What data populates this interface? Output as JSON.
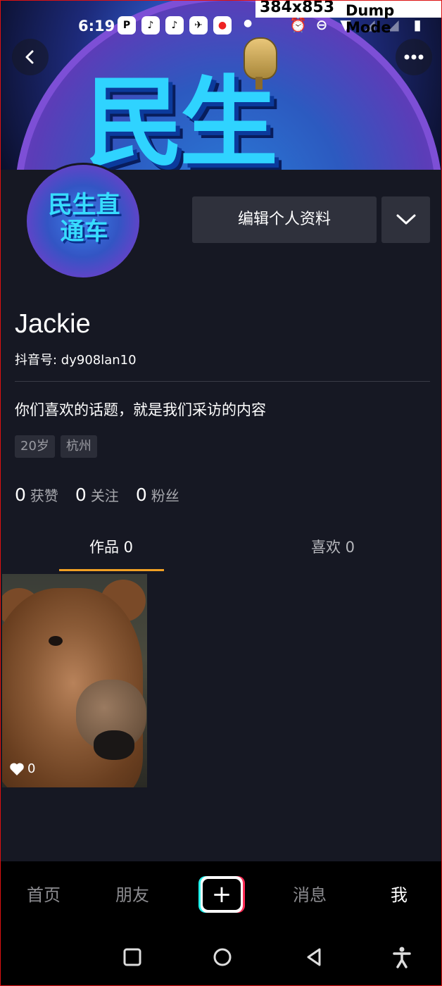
{
  "status_bar": {
    "time": "6:19",
    "debug_resolution": "384x853",
    "debug_mode": "Dump Mode",
    "notification_icons": [
      "P",
      "♪",
      "♪",
      "✈",
      "●"
    ]
  },
  "header": {
    "banner_text": "民生",
    "back_icon": "chevron-left-icon",
    "more_icon": "more-horizontal-icon"
  },
  "profile": {
    "avatar_text": "民生直通车",
    "edit_button_label": "编辑个人资料",
    "name": "Jackie",
    "douyin_id": "抖音号: dy908lan10",
    "bio": "你们喜欢的话题，就是我们采访的内容",
    "tags": [
      "20岁",
      "杭州"
    ],
    "stats": [
      {
        "value": "0",
        "label": "获赞"
      },
      {
        "value": "0",
        "label": "关注"
      },
      {
        "value": "0",
        "label": "粉丝"
      }
    ]
  },
  "tabs": {
    "works": "作品 0",
    "likes": "喜欢 0",
    "active": "works"
  },
  "works": [
    {
      "likes": "0"
    }
  ],
  "bottom_nav": {
    "home": "首页",
    "friends": "朋友",
    "messages": "消息",
    "me": "我",
    "active": "me"
  },
  "colors": {
    "background": "#161823",
    "tab_indicator": "#f0a024",
    "button_bg": "#2f313c",
    "accent_cyan": "#25f4ee",
    "accent_red": "#fe2c55"
  }
}
